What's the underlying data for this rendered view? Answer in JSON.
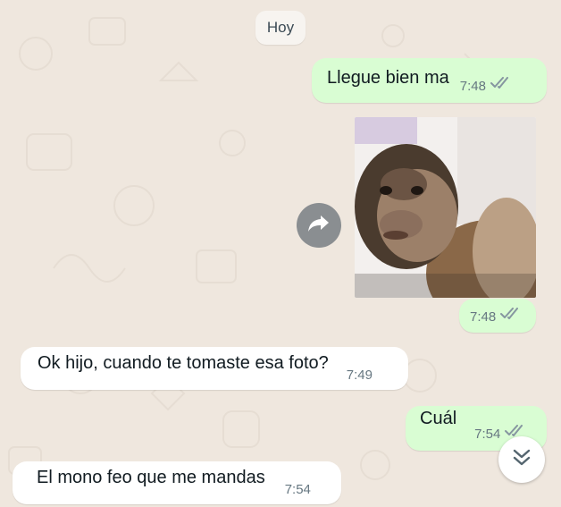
{
  "chat": {
    "date_chip": "Hoy",
    "messages": [
      {
        "text": "Llegue bien ma",
        "time": "7:48"
      },
      {
        "time": "7:48"
      },
      {
        "text": "Ok hijo, cuando te tomaste esa foto?",
        "time": "7:49"
      },
      {
        "text": "Cuál",
        "time": "7:54"
      },
      {
        "text": "El mono feo que me mandas",
        "time": "7:54"
      }
    ]
  },
  "icons": {
    "forward": "forward-arrow-icon",
    "scroll_down": "double-chevron-down-icon",
    "read_receipt": "double-check-icon"
  },
  "colors": {
    "background": "#efe7de",
    "outgoing_bubble": "#d9fdd3",
    "incoming_bubble": "#ffffff",
    "read_ticks": "#8696a0"
  }
}
